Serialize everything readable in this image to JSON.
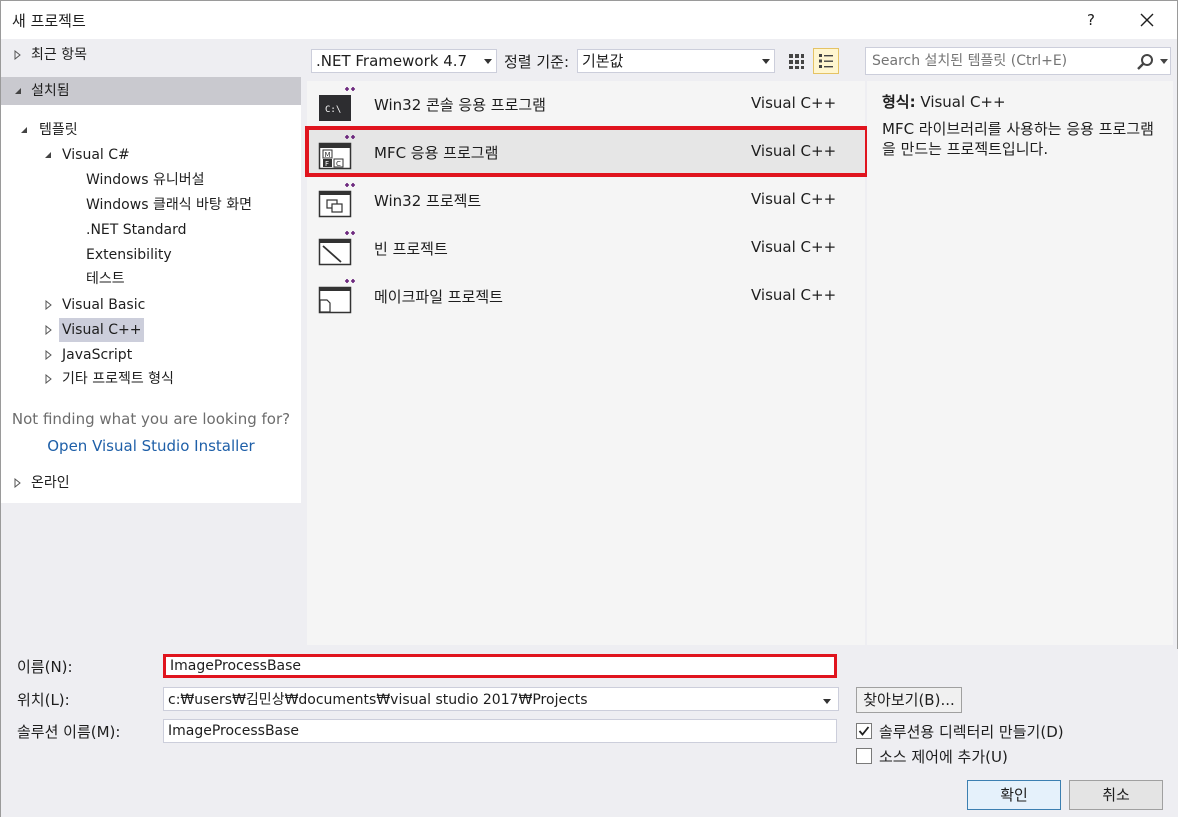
{
  "title_bar": {
    "title": "새 프로젝트",
    "help_label": "?"
  },
  "tree": {
    "recent": "최근 항목",
    "installed": "설치됨",
    "templates": "템플릿",
    "visual_csharp": "Visual C#",
    "csharp_children": [
      "Windows 유니버설",
      "Windows 클래식 바탕 화면",
      ".NET Standard",
      "Extensibility",
      "테스트"
    ],
    "visual_basic": "Visual Basic",
    "visual_cpp": "Visual C++",
    "javascript": "JavaScript",
    "other_types": "기타 프로젝트 형식",
    "not_finding": "Not finding what you are looking for?",
    "open_installer": "Open Visual Studio Installer",
    "online": "온라인"
  },
  "toolbar": {
    "framework": ".NET Framework 4.7",
    "sort_label": "정렬 기준:",
    "sort_value": "기본값",
    "search_placeholder": "Search 설치된 템플릿 (Ctrl+E)"
  },
  "templates": [
    {
      "name": "Win32 콘솔 응용 프로그램",
      "language": "Visual C++",
      "icon": "console-app-icon"
    },
    {
      "name": "MFC 응용 프로그램",
      "language": "Visual C++",
      "icon": "mfc-app-icon"
    },
    {
      "name": "Win32 프로젝트",
      "language": "Visual C++",
      "icon": "win32-project-icon"
    },
    {
      "name": "빈 프로젝트",
      "language": "Visual C++",
      "icon": "empty-project-icon"
    },
    {
      "name": "메이크파일 프로젝트",
      "language": "Visual C++",
      "icon": "makefile-project-icon"
    }
  ],
  "description": {
    "type_label": "형식:",
    "type_value": "Visual C++",
    "text": "MFC 라이브러리를 사용하는 응용 프로그램을 만드는 프로젝트입니다."
  },
  "form": {
    "name_label": "이름(N):",
    "name_value": "ImageProcessBase",
    "location_label": "위치(L):",
    "location_value": "c:₩users₩김민상₩documents₩visual studio 2017₩Projects",
    "solution_label": "솔루션 이름(M):",
    "solution_value": "ImageProcessBase",
    "browse": "찾아보기(B)...",
    "create_dir": "솔루션용 디렉터리 만들기(D)",
    "create_dir_checked": true,
    "source_control": "소스 제어에 추가(U)",
    "source_control_checked": false,
    "ok": "확인",
    "cancel": "취소"
  },
  "colors": {
    "highlight_red": "#e0141e",
    "link_blue": "#1e5fa8",
    "accent_purple": "#68217a"
  }
}
